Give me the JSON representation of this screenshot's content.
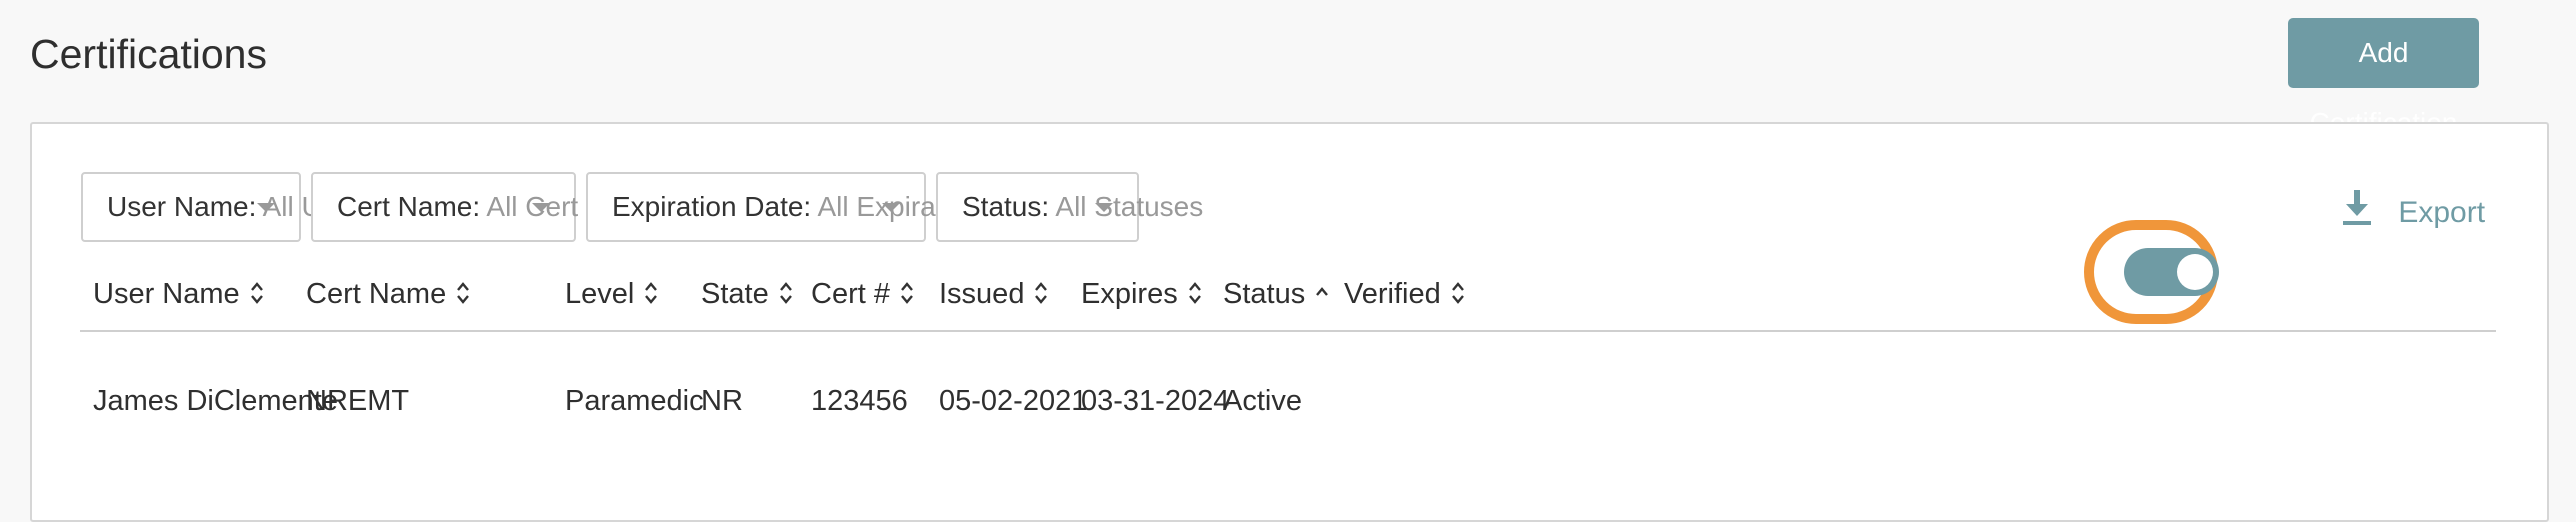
{
  "header": {
    "title": "Certifications",
    "add_button_label": "Add Certification"
  },
  "filters": [
    {
      "label": "User Name:",
      "value": "All Users"
    },
    {
      "label": "Cert Name:",
      "value": "All Cert Names"
    },
    {
      "label": "Expiration Date:",
      "value": "All Expiration Dates"
    },
    {
      "label": "Status:",
      "value": "All Statuses"
    }
  ],
  "export_label": "Export",
  "table": {
    "columns": [
      {
        "label": "User Name",
        "sort": "both"
      },
      {
        "label": "Cert Name",
        "sort": "both"
      },
      {
        "label": "Level",
        "sort": "both"
      },
      {
        "label": "State",
        "sort": "both"
      },
      {
        "label": "Cert #",
        "sort": "both"
      },
      {
        "label": "Issued",
        "sort": "both"
      },
      {
        "label": "Expires",
        "sort": "both"
      },
      {
        "label": "Status",
        "sort": "ascending"
      },
      {
        "label": "Verified",
        "sort": "both"
      }
    ],
    "rows": [
      {
        "user_name": "James DiClemente",
        "cert_name": "NREMT",
        "level": "Paramedic",
        "state": "NR",
        "cert_number": "123456",
        "issued": "05-02-2021",
        "expires": "03-31-2024",
        "status": "Active",
        "verified": true
      }
    ]
  },
  "colors": {
    "accent": "#6f9ba4",
    "highlight_ring": "#f0963a"
  }
}
